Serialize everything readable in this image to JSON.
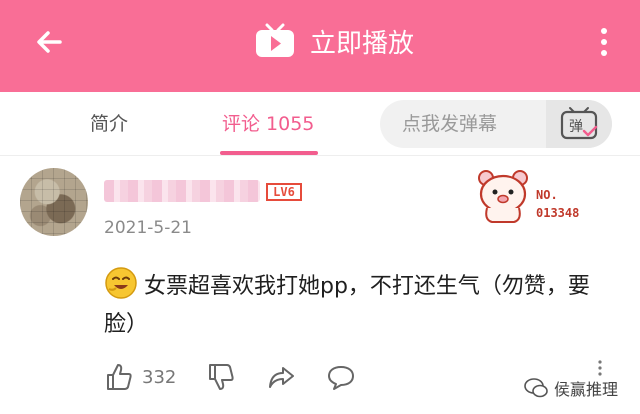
{
  "header": {
    "title": "立即播放",
    "background_color": "#f96e96",
    "back_icon": "arrow-left-icon",
    "menu_icon": "more-vertical-icon"
  },
  "tabs": {
    "intro_label": "简介",
    "comments_label": "评论 1055",
    "active_color": "#f25d8e"
  },
  "danmaku": {
    "placeholder": "点我发弹幕",
    "button_text": "弹"
  },
  "comment": {
    "level": "LV6",
    "date": "2021-5-21",
    "badge_no_label": "NO.",
    "badge_number": "013348",
    "text": "女票超喜欢我打她pp，不打还生气（勿赞，要脸）",
    "like_count": "332"
  },
  "watermark": {
    "text": "侯赢推理"
  }
}
